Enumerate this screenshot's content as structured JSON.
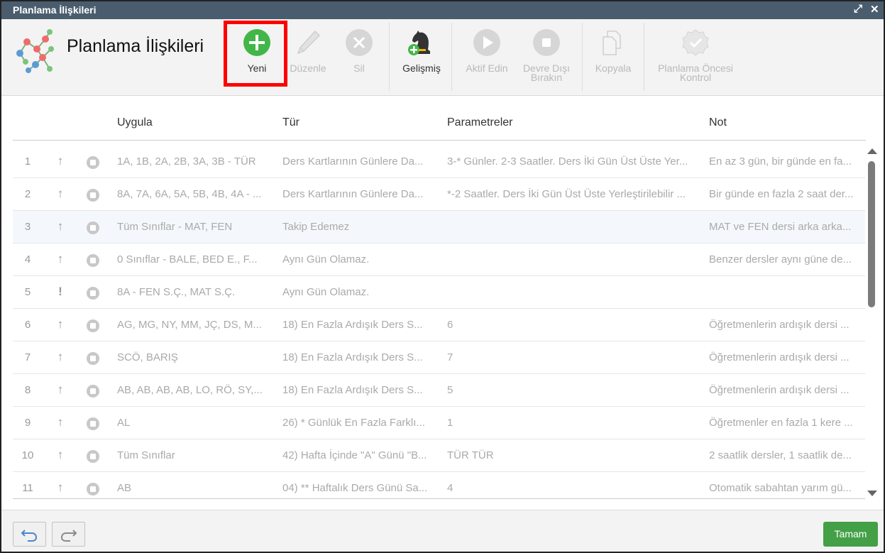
{
  "window": {
    "title": "Planlama İlişkileri"
  },
  "header": {
    "app_title": "Planlama İlişkileri"
  },
  "toolbar": {
    "new": "Yeni",
    "edit": "Düzenle",
    "delete": "Sil",
    "advanced": "Gelişmiş",
    "activate": "Aktif Edin",
    "deactivate_line1": "Devre Dışı",
    "deactivate_line2": "Bırakın",
    "copy": "Kopyala",
    "precheck_line1": "Planlama Öncesi",
    "precheck_line2": "Kontrol"
  },
  "grid": {
    "columns": [
      "Uygula",
      "Tür",
      "Parametreler",
      "Not"
    ],
    "rows": [
      {
        "num": "1",
        "flag": "↑",
        "uygula": "1A, 1B, 2A, 2B, 3A, 3B - TÜR",
        "tur": "Ders Kartlarının Günlere Da...",
        "param": "3-* Günler. 2-3 Saatler. Ders İki Gün Üst Üste Yer...",
        "not": "En az 3 gün, bir günde en fa..."
      },
      {
        "num": "2",
        "flag": "↑",
        "uygula": "8A, 7A, 6A, 5A, 5B, 4B, 4A - ...",
        "tur": "Ders Kartlarının Günlere Da...",
        "param": "*-2 Saatler. Ders İki Gün Üst Üste Yerleştirilebilir ...",
        "not": "Bir günde en fazla 2 saat der..."
      },
      {
        "num": "3",
        "flag": "↑",
        "uygula": "Tüm Sınıflar - MAT, FEN",
        "tur": "Takip Edemez",
        "param": "",
        "not": "MAT ve FEN dersi arka arka..."
      },
      {
        "num": "4",
        "flag": "↑",
        "uygula": "0 Sınıflar - BALE, BED E., F...",
        "tur": "Aynı Gün Olamaz.",
        "param": "",
        "not": "Benzer dersler aynı güne de..."
      },
      {
        "num": "5",
        "flag": "!",
        "uygula": "8A - FEN S.Ç., MAT S.Ç.",
        "tur": "Aynı Gün Olamaz.",
        "param": "",
        "not": ""
      },
      {
        "num": "6",
        "flag": "↑",
        "uygula": "AG, MG, NY, MM, JÇ, DS, M...",
        "tur": "18) En Fazla Ardışık Ders S...",
        "param": "6",
        "not": "Öğretmenlerin ardışık dersi ..."
      },
      {
        "num": "7",
        "flag": "↑",
        "uygula": "SCÖ, BARIŞ",
        "tur": "18) En Fazla Ardışık Ders S...",
        "param": "7",
        "not": "Öğretmenlerin ardışık dersi ..."
      },
      {
        "num": "8",
        "flag": "↑",
        "uygula": "AB, AB, AB, AB, LO, RÖ, SY,...",
        "tur": "18) En Fazla Ardışık Ders S...",
        "param": "5",
        "not": "Öğretmenlerin ardışık dersi ..."
      },
      {
        "num": "9",
        "flag": "↑",
        "uygula": "AL",
        "tur": "26) * Günlük En Fazla Farklı...",
        "param": "1",
        "not": "Öğretmenler en fazla 1 kere ..."
      },
      {
        "num": "10",
        "flag": "↑",
        "uygula": "Tüm Sınıflar",
        "tur": "42) Hafta İçinde \"A\" Günü \"B...",
        "param": "TÜR TÜR",
        "not": "2 saatlik dersler, 1 saatlik de..."
      },
      {
        "num": "11",
        "flag": "↑",
        "uygula": "AB",
        "tur": "04) ** Haftalık Ders Günü Sa...",
        "param": "4",
        "not": "Otomatik sabahtan yarım gü..."
      }
    ]
  },
  "footer": {
    "ok": "Tamam"
  },
  "colors": {
    "titlebar": "#4a5d6e",
    "accent_green": "#43a047",
    "highlight_red": "#ff0000",
    "disabled_icon": "#d6d6d6"
  },
  "icons": {
    "new": "plus-circle-icon",
    "edit": "pencil-icon",
    "delete": "x-circle-icon",
    "advanced": "chess-knight-icon",
    "activate": "play-circle-icon",
    "deactivate": "stop-circle-icon",
    "copy": "copy-icon",
    "precheck": "check-badge-icon"
  }
}
